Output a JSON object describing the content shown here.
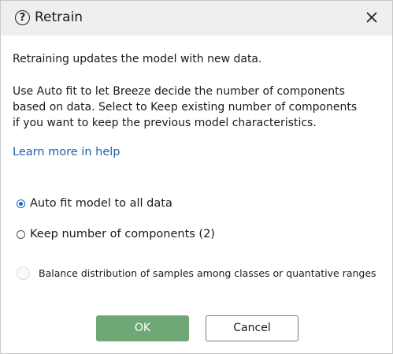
{
  "dialog": {
    "title": "Retrain",
    "paragraph1": "Retraining updates the model with new data.",
    "paragraph2": "Use Auto fit to let Breeze decide the number of components based on data. Select to Keep existing number of components if you want to keep the previous model characteristics.",
    "help_link": "Learn more in help"
  },
  "options": {
    "auto_fit": {
      "label": "Auto fit model to all data",
      "selected": true
    },
    "keep_components": {
      "label": "Keep number of components (2)",
      "selected": false
    },
    "balance": {
      "label": "Balance distribution of samples among classes or quantative ranges",
      "checked": false,
      "enabled": false
    }
  },
  "buttons": {
    "ok": "OK",
    "cancel": "Cancel"
  },
  "colors": {
    "ok_button": "#6fa876",
    "link": "#1f5fa6",
    "radio_selected": "#1565c0",
    "titlebar": "#efefef"
  },
  "icons": {
    "title": "help-circle-icon",
    "close": "close-icon"
  }
}
